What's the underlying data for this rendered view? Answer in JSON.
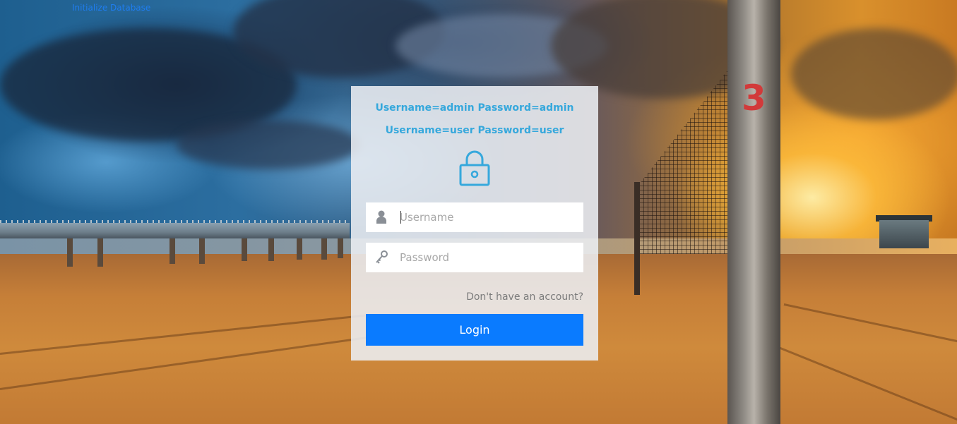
{
  "top_link": {
    "label": "Initialize Database"
  },
  "login_panel": {
    "credentials": [
      "Username=admin Password=admin",
      "Username=user Password=user"
    ],
    "lock_icon": "lock-icon",
    "username": {
      "icon": "user-icon",
      "placeholder": "Username",
      "value": ""
    },
    "password": {
      "icon": "key-icon",
      "placeholder": "Password",
      "value": ""
    },
    "signup_link": "Don't have an account?",
    "login_button": "Login"
  },
  "colors": {
    "accent_text": "#36a8dc",
    "button": "#0a7bff",
    "link": "#1f7df0",
    "panel_bg": "rgba(236,238,242,0.88)"
  },
  "background": {
    "icon": "beach-sunset-image"
  }
}
